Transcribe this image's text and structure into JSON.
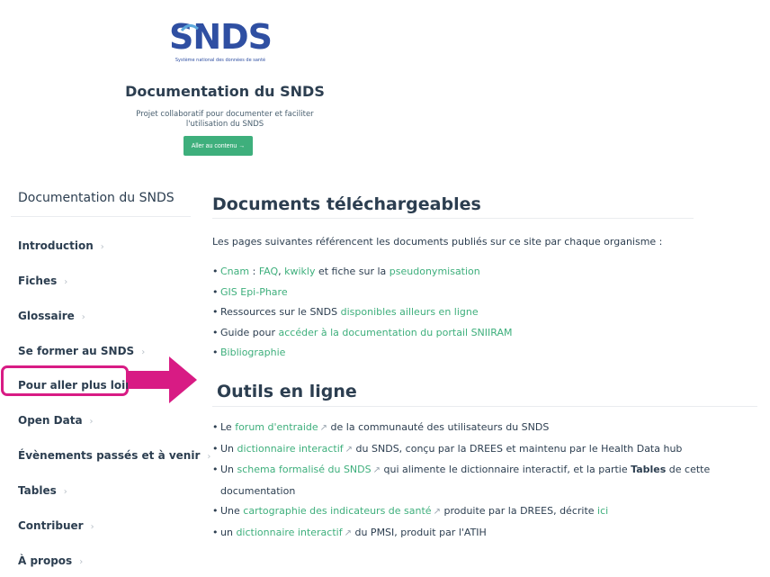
{
  "header": {
    "logo_text": "SNDS",
    "logo_subtitle": "Système national des données de santé",
    "title": "Documentation du SNDS",
    "description_line1": "Projet collaboratif pour documenter et faciliter",
    "description_line2": "l'utilisation du SNDS",
    "button_label": "Aller au contenu →"
  },
  "sidebar": {
    "title": "Documentation du SNDS",
    "chevron": "›",
    "items": [
      {
        "label": "Introduction",
        "chevron": true
      },
      {
        "label": "Fiches",
        "chevron": true
      },
      {
        "label": "Glossaire",
        "chevron": true
      },
      {
        "label": "Se former au SNDS",
        "chevron": true
      },
      {
        "label": "Pour aller plus loin",
        "chevron": false
      },
      {
        "label": "Open Data",
        "chevron": true
      },
      {
        "label": "Évènements passés et à venir",
        "chevron": true
      },
      {
        "label": "Tables",
        "chevron": true
      },
      {
        "label": "Contribuer",
        "chevron": true
      },
      {
        "label": "À propos",
        "chevron": true
      }
    ]
  },
  "content": {
    "section1": {
      "heading": "Documents téléchargeables",
      "intro": "Les pages suivantes référencent les documents publiés sur ce site par chaque organisme :",
      "items": {
        "cnam": {
          "link1": "Cnam",
          "t1": " : ",
          "link2": "FAQ",
          "t2": ", ",
          "link3": "kwikly",
          "t3": " et fiche sur la ",
          "link4": "pseudonymisation"
        },
        "gis": {
          "link1": "GIS Epi-Phare"
        },
        "ressources": {
          "t1": "Ressources sur le SNDS ",
          "link1": "disponibles ailleurs en ligne"
        },
        "guide": {
          "t1": "Guide pour ",
          "link1": "accéder à la documentation du portail SNIIRAM"
        },
        "biblio": {
          "link1": "Bibliographie"
        }
      }
    },
    "section2": {
      "heading": "Outils en ligne",
      "items": {
        "forum": {
          "t1": "Le ",
          "link1": "forum d'entraide",
          "t2": " de la communauté des utilisateurs du SNDS"
        },
        "dico": {
          "t1": "Un ",
          "link1": "dictionnaire interactif",
          "t2": " du SNDS, conçu par la DREES et maintenu par le Health Data hub"
        },
        "schema": {
          "t1": "Un ",
          "link1": "schema formalisé du SNDS",
          "t2": " qui alimente le dictionnaire interactif, et la partie ",
          "bold": "Tables",
          "t3": " de cette",
          "t4": "documentation"
        },
        "carto": {
          "t1": "Une ",
          "link1": "cartographie des indicateurs de santé",
          "t2": " produite par la DREES, décrite ",
          "link2": "ici"
        },
        "pmsi": {
          "t1": "un ",
          "link1": "dictionnaire interactif",
          "t2": " du PMSI, produit par l'ATIH"
        }
      },
      "external_icon": "↗"
    }
  },
  "colors": {
    "accent_green": "#3eaf7c",
    "highlight_pink": "#d81b84",
    "logo_blue": "#2f4fa2",
    "text": "#2c3e50"
  }
}
